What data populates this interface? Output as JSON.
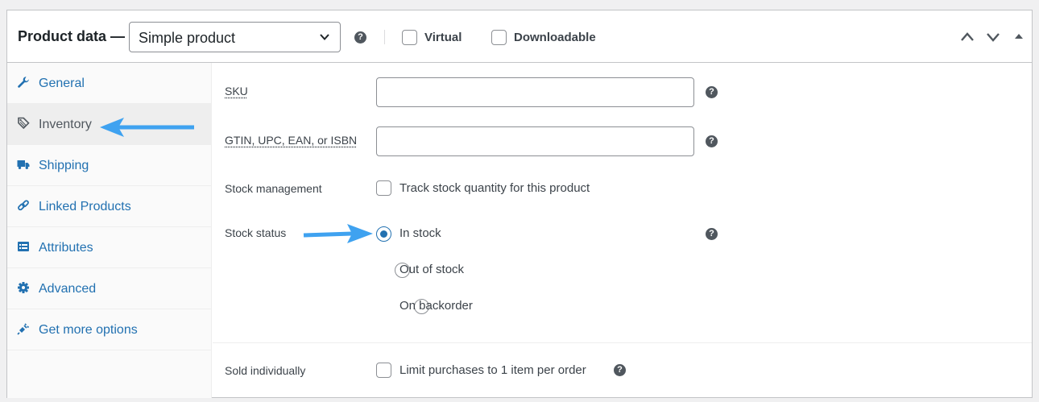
{
  "header": {
    "title": "Product data —",
    "product_type": "Simple product",
    "virtual_label": "Virtual",
    "downloadable_label": "Downloadable",
    "help": "?"
  },
  "tabs": [
    {
      "label": "General",
      "icon": "wrench-icon"
    },
    {
      "label": "Inventory",
      "icon": "tag-icon",
      "active": true
    },
    {
      "label": "Shipping",
      "icon": "truck-icon"
    },
    {
      "label": "Linked Products",
      "icon": "link-icon"
    },
    {
      "label": "Attributes",
      "icon": "list-icon"
    },
    {
      "label": "Advanced",
      "icon": "gear-icon"
    },
    {
      "label": "Get more options",
      "icon": "plugin-icon"
    }
  ],
  "fields": {
    "sku_label": "SKU",
    "sku_value": "",
    "gtin_label": "GTIN, UPC, EAN, or ISBN",
    "gtin_value": "",
    "stock_management_label": "Stock management",
    "stock_management_option": "Track stock quantity for this product",
    "stock_status_label": "Stock status",
    "stock_status_options": [
      "In stock",
      "Out of stock",
      "On backorder"
    ],
    "stock_status_selected": "In stock",
    "sold_individually_label": "Sold individually",
    "sold_individually_option": "Limit purchases to 1 item per order"
  },
  "colors": {
    "accent": "#2271b1",
    "annotation_arrow": "#3fa2f0"
  }
}
